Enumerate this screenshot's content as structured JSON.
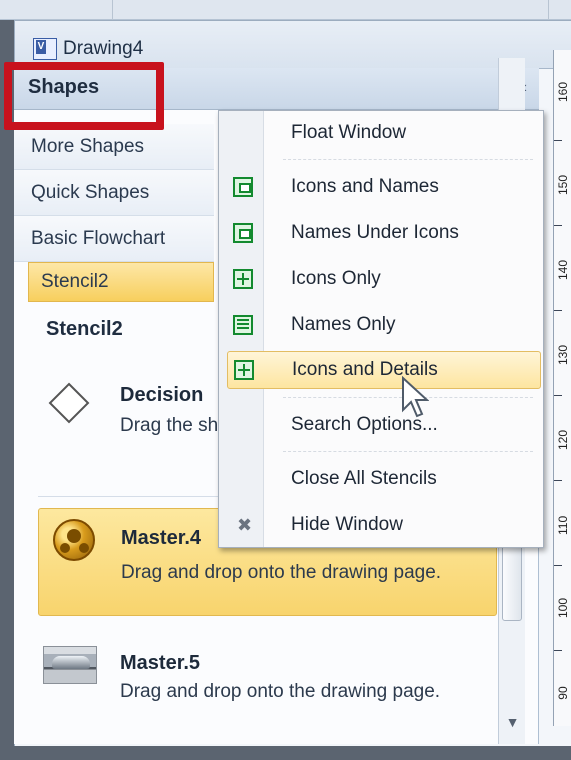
{
  "document": {
    "tab_title": "Drawing4",
    "icon": "visio-document-icon"
  },
  "shapes_panel": {
    "title": "Shapes",
    "collapse_icon": "collapse-arrow-icon",
    "items": [
      {
        "label": "More Shapes"
      },
      {
        "label": "Quick Shapes"
      },
      {
        "label": "Basic Flowchart"
      },
      {
        "label": "Stencil2",
        "active": true
      }
    ],
    "section_title": "Stencil2",
    "shapes": [
      {
        "name": "Decision",
        "description": "Drag the shape onto the page."
      },
      {
        "name": "Master.4",
        "description": "Drag and drop onto the drawing page.",
        "selected": true
      },
      {
        "name": "Master.5",
        "description": "Drag and drop onto the drawing page."
      }
    ]
  },
  "context_menu": {
    "items": [
      {
        "label": "Float Window",
        "icon": "none"
      },
      {
        "label": "Icons and Names",
        "icon": "icons-and-names-icon"
      },
      {
        "label": "Names Under Icons",
        "icon": "names-under-icons-icon"
      },
      {
        "label": "Icons Only",
        "icon": "icons-only-icon"
      },
      {
        "label": "Names Only",
        "icon": "names-only-icon"
      },
      {
        "label": "Icons and Details",
        "icon": "icons-and-details-icon",
        "highlighted": true
      },
      {
        "label": "Search Options...",
        "icon": "none"
      },
      {
        "label": "Close All Stencils",
        "icon": "none"
      },
      {
        "label": "Hide Window",
        "icon": "hide-window-icon"
      }
    ]
  },
  "ruler": {
    "labels": [
      "160",
      "150",
      "140",
      "130",
      "120",
      "110",
      "100",
      "90"
    ]
  },
  "colors": {
    "highlight_box": "#c8121d",
    "active_item": "#f7cf5d",
    "menu_hover": "#fde5a0",
    "menu_icon": "#138a2f"
  }
}
